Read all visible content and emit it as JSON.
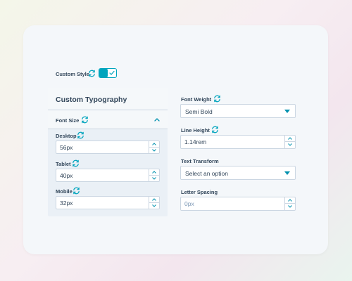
{
  "colors": {
    "accent": "#00a4bd",
    "text": "#33475b",
    "border": "#cbd6e2",
    "placeholder": "#7c98b6"
  },
  "custom_style": {
    "label": "Custom Style",
    "icon": "sync-icon",
    "toggle_on": true
  },
  "typography_panel": {
    "title": "Custom Typography",
    "font_size": {
      "label": "Font Size",
      "expanded": true
    },
    "desktop": {
      "label": "Desktop",
      "value": "56px"
    },
    "tablet": {
      "label": "Tablet",
      "value": "40px"
    },
    "mobile": {
      "label": "Mobile",
      "value": "32px"
    }
  },
  "right": {
    "font_weight": {
      "label": "Font Weight",
      "value": "Semi Bold"
    },
    "line_height": {
      "label": "Line Height",
      "value": "1.14rem"
    },
    "text_transform": {
      "label": "Text Transform",
      "value": "Select an option"
    },
    "letter_spacing": {
      "label": "Letter Spacing",
      "placeholder": "0px"
    }
  }
}
